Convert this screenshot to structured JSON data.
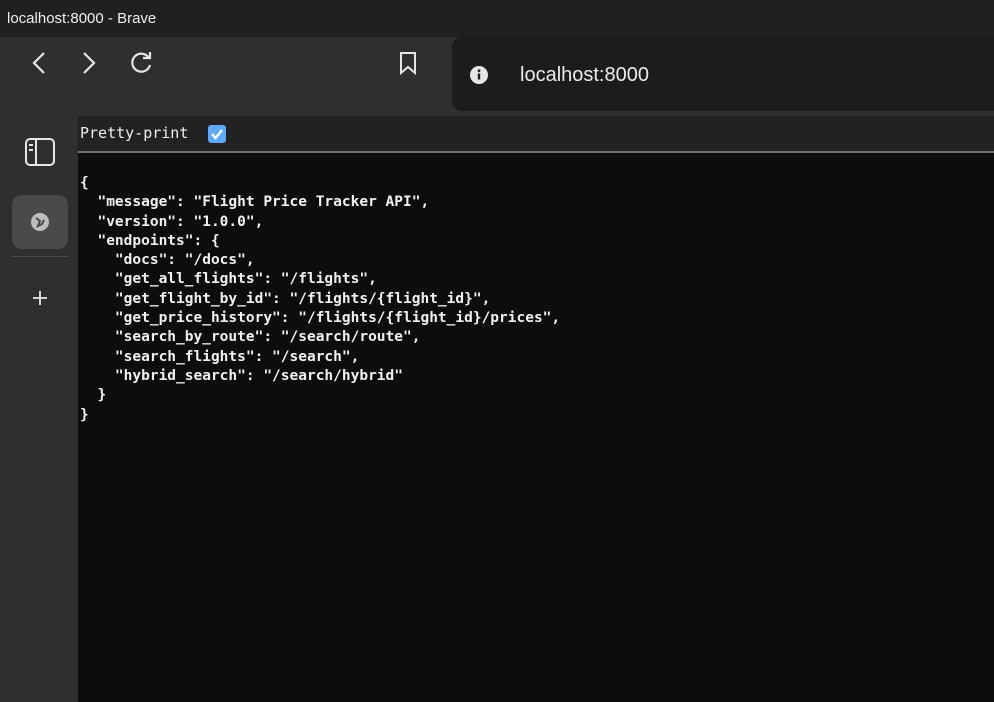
{
  "window": {
    "title": "localhost:8000 - Brave"
  },
  "toolbar": {
    "back_icon": "chevron-left-icon",
    "forward_icon": "chevron-right-icon",
    "reload_icon": "reload-icon",
    "bookmark_icon": "bookmark-icon",
    "site_info_icon": "info-icon",
    "url": "localhost:8000"
  },
  "sidebar": {
    "panel_toggle_icon": "sidebar-panel-icon",
    "tab_icon": "globe-icon",
    "add_icon": "plus-icon"
  },
  "viewer": {
    "pretty_print_label": "Pretty-print",
    "pretty_print_checked": true,
    "json_lines": [
      "{",
      "  \"message\": \"Flight Price Tracker API\",",
      "  \"version\": \"1.0.0\",",
      "  \"endpoints\": {",
      "    \"docs\": \"/docs\",",
      "    \"get_all_flights\": \"/flights\",",
      "    \"get_flight_by_id\": \"/flights/{flight_id}\",",
      "    \"get_price_history\": \"/flights/{flight_id}/prices\",",
      "    \"search_by_route\": \"/search/route\",",
      "    \"search_flights\": \"/search\",",
      "    \"hybrid_search\": \"/search/hybrid\"",
      "  }",
      "}"
    ]
  },
  "colors": {
    "checkbox": "#5da9ff",
    "content_bg": "#0d0d0d",
    "chrome_bg": "#2f2f2f"
  }
}
